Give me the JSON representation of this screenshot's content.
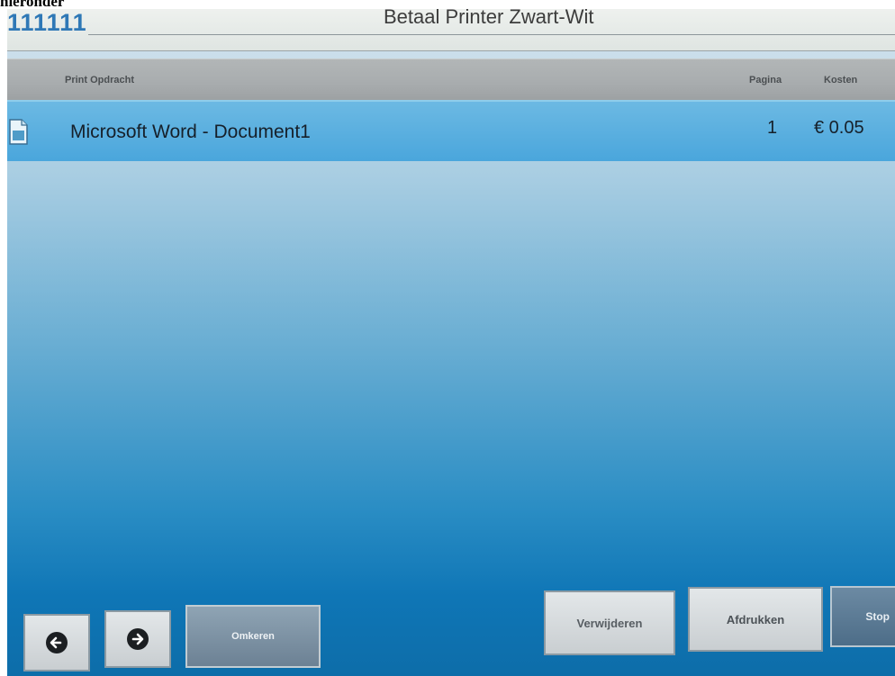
{
  "caption": "nieronder",
  "app": {
    "user_id": "111111",
    "title": "Betaal Printer Zwart-Wit"
  },
  "table": {
    "columns": [
      "Print Opdracht",
      "Pagina",
      "Kosten"
    ],
    "rows": [
      {
        "icon": "document-icon",
        "name": "Microsoft Word - Document1",
        "pages": "1",
        "cost": "€ 0.05"
      }
    ]
  },
  "buttons": {
    "back_icon": "arrow-left-icon",
    "forward_icon": "arrow-right-icon",
    "undo": "Omkeren",
    "delete": "Verwijderen",
    "print": "Afdrukken",
    "stop": "Stop"
  },
  "colors": {
    "accent": "#2f78b6",
    "selected_row": "#4aa6dc",
    "header": "#a8acae"
  }
}
